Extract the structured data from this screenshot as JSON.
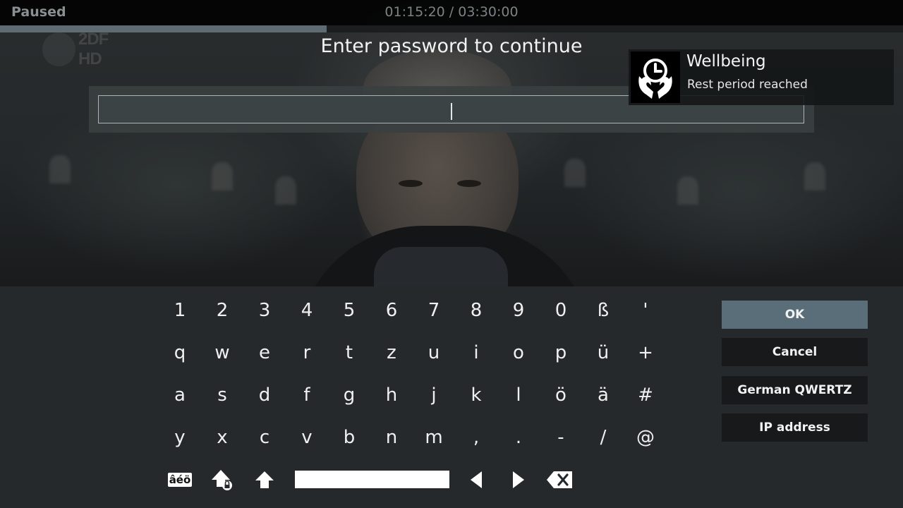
{
  "player": {
    "status": "Paused",
    "time_display": "01:15:20 / 03:30:00",
    "progress_fraction": 0.3619,
    "channel_logo": "2DF HD"
  },
  "dialog": {
    "title": "Enter password to continue",
    "password_value": ""
  },
  "notification": {
    "title": "Wellbeing",
    "message": "Rest period reached",
    "icon": "clock-hands-icon"
  },
  "keyboard": {
    "rows": [
      [
        "1",
        "2",
        "3",
        "4",
        "5",
        "6",
        "7",
        "8",
        "9",
        "0",
        "ß",
        "'"
      ],
      [
        "q",
        "w",
        "e",
        "r",
        "t",
        "z",
        "u",
        "i",
        "o",
        "p",
        "ü",
        "+"
      ],
      [
        "a",
        "s",
        "d",
        "f",
        "g",
        "h",
        "j",
        "k",
        "l",
        "ö",
        "ä",
        "#"
      ],
      [
        "y",
        "x",
        "c",
        "v",
        "b",
        "n",
        "m",
        ",",
        ".",
        "-",
        "/",
        "@"
      ]
    ],
    "accents_label": "âéö",
    "function_icons": [
      "accents-icon",
      "caps-lock-icon",
      "shift-icon",
      "space-bar",
      "cursor-left-icon",
      "cursor-right-icon",
      "backspace-icon"
    ],
    "buttons": {
      "ok": "OK",
      "cancel": "Cancel",
      "layout": "German QWERTZ",
      "ip_address": "IP address"
    }
  }
}
